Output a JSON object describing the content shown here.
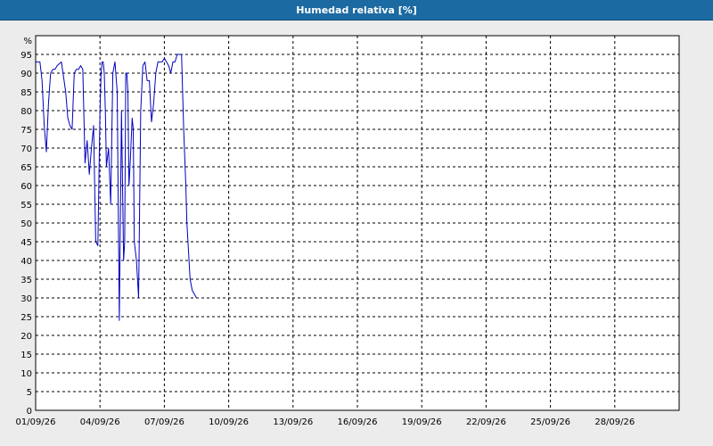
{
  "chart_data": {
    "type": "line",
    "title": "Humedad relativa [%]",
    "ylabel": "%",
    "xlabel": "",
    "ylim": [
      0,
      100
    ],
    "xlim": [
      "01/09/26",
      "31/09/26"
    ],
    "y_ticks": [
      0,
      5,
      10,
      15,
      20,
      25,
      30,
      35,
      40,
      45,
      50,
      55,
      60,
      65,
      70,
      75,
      80,
      85,
      90,
      95
    ],
    "x_ticks": [
      "01/09/26",
      "04/09/26",
      "07/09/26",
      "10/09/26",
      "13/09/26",
      "16/09/26",
      "19/09/26",
      "22/09/26",
      "25/09/26",
      "28/09/26"
    ],
    "grid": true,
    "line_color": "#0000c0",
    "series": [
      {
        "x": [
          1.0,
          1.1,
          1.2,
          1.3,
          1.4,
          1.5,
          1.6,
          1.7,
          1.8,
          1.9,
          2.0,
          2.2,
          2.4,
          2.5,
          2.6,
          2.7,
          2.8,
          2.9,
          3.0,
          3.1,
          3.2,
          3.3,
          3.4,
          3.5,
          3.6,
          3.7,
          3.8,
          3.9,
          4.0,
          4.05,
          4.1,
          4.15,
          4.2,
          4.25,
          4.3,
          4.4,
          4.5,
          4.6,
          4.7,
          4.8,
          4.9,
          5.0,
          5.1,
          5.15,
          5.2,
          5.25,
          5.3,
          5.35,
          5.4,
          5.5,
          5.55,
          5.6,
          5.7,
          5.8,
          5.9,
          6.0,
          6.1,
          6.2,
          6.3,
          6.4,
          6.5,
          6.6,
          6.7,
          6.8,
          6.9,
          7.0,
          7.1,
          7.2,
          7.3,
          7.4,
          7.5,
          7.6,
          7.7,
          7.8,
          7.9,
          8.0,
          8.05,
          8.1,
          8.2,
          8.3,
          8.4,
          8.5
        ],
        "y": [
          93,
          93,
          93,
          88,
          76,
          69,
          82,
          90,
          91,
          91,
          92,
          93,
          85,
          78,
          76,
          75,
          90,
          91,
          91,
          92,
          91,
          66,
          72,
          63,
          70,
          76,
          45,
          44,
          80,
          90,
          93,
          93,
          90,
          80,
          65,
          70,
          55,
          90,
          93,
          85,
          24,
          80,
          40,
          45,
          90,
          90,
          85,
          60,
          65,
          78,
          75,
          45,
          40,
          30,
          80,
          92,
          93,
          88,
          88,
          77,
          82,
          90,
          93,
          93,
          93,
          94,
          93,
          92,
          90,
          93,
          93,
          95,
          95,
          95,
          75,
          60,
          50,
          45,
          35,
          32,
          31,
          30
        ]
      }
    ]
  }
}
